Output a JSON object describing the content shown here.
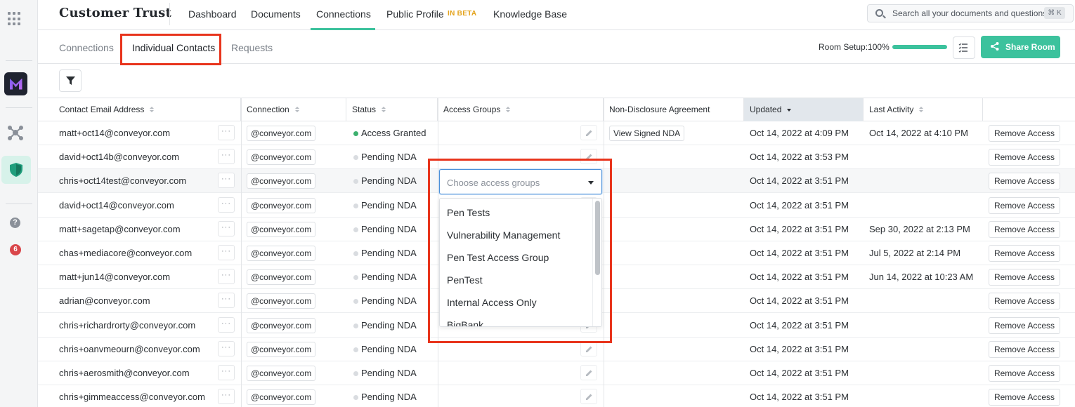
{
  "app": {
    "brand": "Customer Trust"
  },
  "nav": {
    "items": [
      {
        "label": "Dashboard"
      },
      {
        "label": "Documents"
      },
      {
        "label": "Connections"
      },
      {
        "label": "Public Profile"
      },
      {
        "label": "Knowledge Base"
      }
    ],
    "beta_badge": "IN BETA",
    "search_placeholder": "Search all your documents and questions",
    "search_shortcut": "⌘ K"
  },
  "rail": {
    "notification_count": "6",
    "help": "?"
  },
  "subtabs": [
    {
      "label": "Connections"
    },
    {
      "label": "Individual Contacts"
    },
    {
      "label": "Requests"
    }
  ],
  "room": {
    "setup_label": "Room Setup:",
    "setup_value": "100%",
    "setup_progress": 1.0,
    "share_label": "Share Room"
  },
  "colors": {
    "accent": "#3cc29d",
    "highlight": "#e8341c",
    "granted": "#3cb06e"
  },
  "table": {
    "headers": {
      "email": "Contact Email Address",
      "connection": "Connection",
      "status": "Status",
      "access_groups": "Access Groups",
      "nda": "Non-Disclosure Agreement",
      "updated": "Updated",
      "last_activity": "Last Activity"
    },
    "more_label": "···",
    "remove_label": "Remove Access",
    "rows": [
      {
        "email": "matt+oct14@conveyor.com",
        "connection": "@conveyor.com",
        "status": "Access Granted",
        "nda": "View Signed NDA",
        "updated": "Oct 14, 2022 at 4:09 PM",
        "last_activity": "Oct 14, 2022 at 4:10 PM"
      },
      {
        "email": "david+oct14b@conveyor.com",
        "connection": "@conveyor.com",
        "status": "Pending NDA",
        "nda": "",
        "updated": "Oct 14, 2022 at 3:53 PM",
        "last_activity": ""
      },
      {
        "email": "chris+oct14test@conveyor.com",
        "connection": "@conveyor.com",
        "status": "Pending NDA",
        "nda": "",
        "updated": "Oct 14, 2022 at 3:51 PM",
        "last_activity": ""
      },
      {
        "email": "david+oct14@conveyor.com",
        "connection": "@conveyor.com",
        "status": "Pending NDA",
        "nda": "",
        "updated": "Oct 14, 2022 at 3:51 PM",
        "last_activity": ""
      },
      {
        "email": "matt+sagetap@conveyor.com",
        "connection": "@conveyor.com",
        "status": "Pending NDA",
        "nda": "",
        "updated": "Oct 14, 2022 at 3:51 PM",
        "last_activity": "Sep 30, 2022 at 2:13 PM"
      },
      {
        "email": "chas+mediacore@conveyor.com",
        "connection": "@conveyor.com",
        "status": "Pending NDA",
        "nda": "",
        "updated": "Oct 14, 2022 at 3:51 PM",
        "last_activity": "Jul 5, 2022 at 2:14 PM"
      },
      {
        "email": "matt+jun14@conveyor.com",
        "connection": "@conveyor.com",
        "status": "Pending NDA",
        "nda": "",
        "updated": "Oct 14, 2022 at 3:51 PM",
        "last_activity": "Jun 14, 2022 at 10:23 AM"
      },
      {
        "email": "adrian@conveyor.com",
        "connection": "@conveyor.com",
        "status": "Pending NDA",
        "nda": "",
        "updated": "Oct 14, 2022 at 3:51 PM",
        "last_activity": ""
      },
      {
        "email": "chris+richardrorty@conveyor.com",
        "connection": "@conveyor.com",
        "status": "Pending NDA",
        "nda": "",
        "updated": "Oct 14, 2022 at 3:51 PM",
        "last_activity": ""
      },
      {
        "email": "chris+oanvmeourn@conveyor.com",
        "connection": "@conveyor.com",
        "status": "Pending NDA",
        "nda": "",
        "updated": "Oct 14, 2022 at 3:51 PM",
        "last_activity": ""
      },
      {
        "email": "chris+aerosmith@conveyor.com",
        "connection": "@conveyor.com",
        "status": "Pending NDA",
        "nda": "",
        "updated": "Oct 14, 2022 at 3:51 PM",
        "last_activity": ""
      },
      {
        "email": "chris+gimmeaccess@conveyor.com",
        "connection": "@conveyor.com",
        "status": "Pending NDA",
        "nda": "",
        "updated": "Oct 14, 2022 at 3:51 PM",
        "last_activity": ""
      }
    ]
  },
  "access_dropdown": {
    "placeholder": "Choose access groups",
    "options": [
      "Pen Tests",
      "Vulnerability Management",
      "Pen Test Access Group",
      "PenTest",
      "Internal Access Only",
      "BigBank"
    ]
  }
}
